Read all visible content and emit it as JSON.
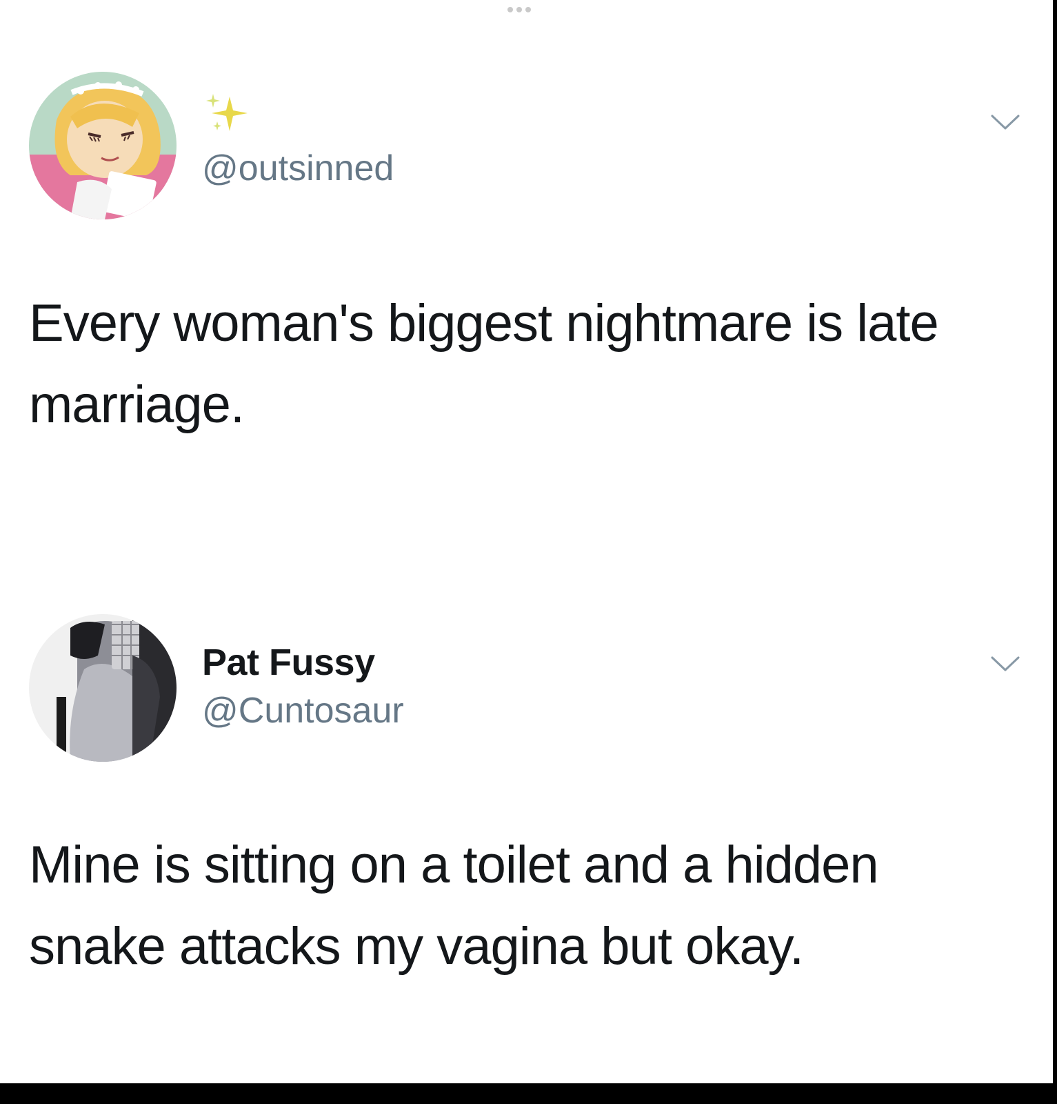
{
  "top_indicator": {
    "icon": "more-dots-icon"
  },
  "tweets": [
    {
      "display_name": "",
      "display_name_icon": "sparkles-icon",
      "handle": "@outsinned",
      "text": "Every woman's biggest nightmare is late marriage.",
      "menu_icon": "chevron-down-icon",
      "avatar_icon": "cartoon-avatar-icon"
    },
    {
      "display_name": "Pat Fussy",
      "handle": "@Cuntosaur",
      "text": "Mine is sitting on a toilet and a hidden snake attacks my vagina but okay.",
      "menu_icon": "chevron-down-icon",
      "avatar_icon": "photo-avatar-icon"
    }
  ],
  "colors": {
    "background": "#ffffff",
    "text": "#14171a",
    "handle": "#657786",
    "sparkle": "#e8d84a",
    "chevron": "#8899a6",
    "frame": "#000000"
  }
}
